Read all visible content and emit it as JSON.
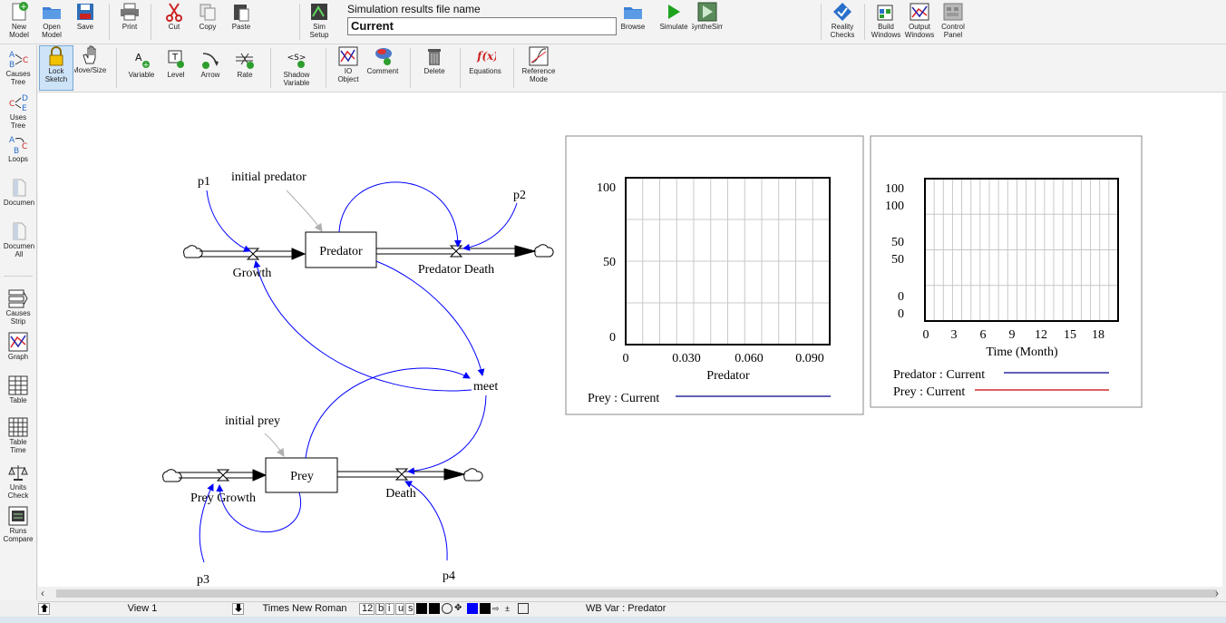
{
  "toolbar1": {
    "new_model": "New\nModel",
    "open_model": "Open\nModel",
    "save": "Save",
    "print": "Print",
    "cut": "Cut",
    "copy": "Copy",
    "paste": "Paste",
    "sim_setup": "Sim\nSetup",
    "sim_label": "Simulation results file name",
    "sim_value": "Current",
    "browse": "Browse",
    "simulate": "Simulate",
    "synthesim": "SyntheSim",
    "reality_checks": "Reality\nChecks",
    "build_windows": "Build\nWindows",
    "output_windows": "Output\nWindows",
    "control_panel": "Control\nPanel"
  },
  "toolbar2": {
    "lock_sketch": "Lock\nSketch",
    "move_size": "Move/Size",
    "variable": "Variable",
    "level": "Level",
    "arrow": "Arrow",
    "rate": "Rate",
    "shadow_variable": "Shadow\nVariable",
    "io_object": "IO\nObject",
    "comment": "Comment",
    "delete": "Delete",
    "equations": "Equations",
    "reference_mode": "Reference\nMode"
  },
  "leftbar": {
    "causes_tree": "Causes\nTree",
    "uses_tree": "Uses Tree",
    "loops": "Loops",
    "document": "Documen",
    "document_all": "Documen\nAll",
    "causes_strip": "Causes\nStrip",
    "graph": "Graph",
    "table": "Table",
    "table_time": "Table\nTime",
    "units_check": "Units\nCheck",
    "runs_compare": "Runs\nCompare"
  },
  "model": {
    "p1": "p1",
    "p2": "p2",
    "p3": "p3",
    "p4": "p4",
    "initial_predator": "initial predator",
    "predator": "Predator",
    "growth": "Growth",
    "predator_death": "Predator Death",
    "meet": "meet",
    "initial_prey": "initial prey",
    "prey": "Prey",
    "prey_growth": "Prey Growth",
    "death": "Death"
  },
  "chart_data": [
    {
      "type": "line",
      "x_ticks": [
        "0",
        "0.030",
        "0.060",
        "0.090"
      ],
      "y_ticks": [
        "100",
        "50",
        "0"
      ],
      "xlabel": "Predator",
      "ylabel": "",
      "series": [
        {
          "name": "Prey : Current",
          "color": "#00008b",
          "values": []
        }
      ],
      "grid": true,
      "legend": "bottom"
    },
    {
      "type": "line",
      "x_ticks": [
        "0",
        "3",
        "6",
        "9",
        "12",
        "15",
        "18"
      ],
      "y_ticks_left1": [
        "100",
        "50",
        "0"
      ],
      "y_ticks_left2": [
        "100",
        "50",
        "0"
      ],
      "xlabel": "Time (Month)",
      "ylabel": "",
      "series": [
        {
          "name": "Predator : Current",
          "color": "#00008b",
          "values": []
        },
        {
          "name": "Prey : Current",
          "color": "#cc0000",
          "values": []
        }
      ],
      "grid": true,
      "legend": "bottom"
    }
  ],
  "statusbar": {
    "view": "View 1",
    "font": "Times New Roman",
    "size": "12",
    "b": "b",
    "i": "i",
    "u": "u",
    "s": "s",
    "wb_var": "WB Var : Predator"
  }
}
